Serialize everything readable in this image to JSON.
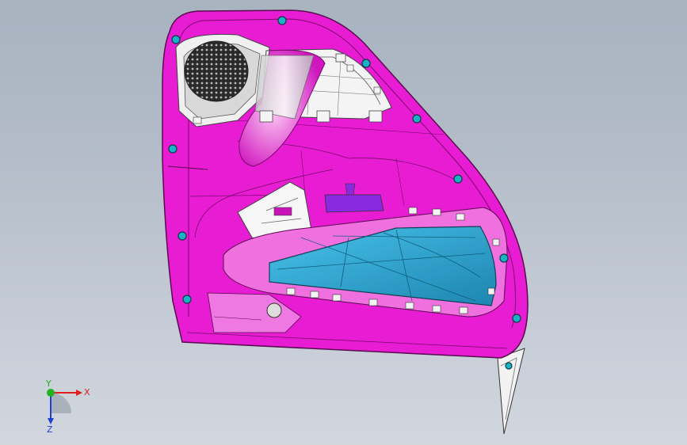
{
  "viewport": {
    "background_top": "#a8b3c0",
    "background_bottom": "#d2d7de"
  },
  "model": {
    "panel_color": "#e81cd2",
    "panel_dark": "#b010a0",
    "edge_color": "#5a0a50",
    "pocket_color": "#2aa3d0",
    "pocket_dark": "#1a6e90",
    "clip_color": "#19b3c7",
    "metal_color": "#e6e6ea"
  },
  "triad": {
    "x_label": "X",
    "y_label": "Y",
    "z_label": "Z",
    "x_color": "#e02020",
    "y_color": "#20b020",
    "z_color": "#2040d0"
  }
}
